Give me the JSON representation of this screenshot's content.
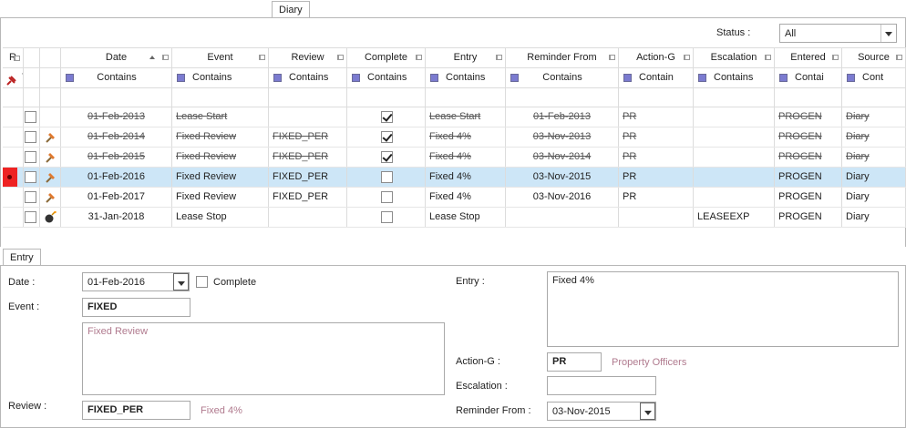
{
  "tabs": {
    "top": "Diary",
    "bottom": "Entry"
  },
  "status": {
    "label": "Status :",
    "value": "All"
  },
  "grid": {
    "columns": [
      {
        "key": "r",
        "label": "R"
      },
      {
        "key": "c1",
        "label": ""
      },
      {
        "key": "c2",
        "label": ""
      },
      {
        "key": "date",
        "label": "Date"
      },
      {
        "key": "event",
        "label": "Event"
      },
      {
        "key": "review",
        "label": "Review"
      },
      {
        "key": "complete",
        "label": "Complete"
      },
      {
        "key": "entry",
        "label": "Entry"
      },
      {
        "key": "reminder",
        "label": "Reminder From"
      },
      {
        "key": "action",
        "label": "Action-G"
      },
      {
        "key": "escalation",
        "label": "Escalation"
      },
      {
        "key": "entered",
        "label": "Entered"
      },
      {
        "key": "source",
        "label": "Source"
      }
    ],
    "filters": {
      "r_dot": "·",
      "c1_dot": "·",
      "date": "Contains",
      "event": "Contains",
      "review": "Contains",
      "complete": "Contains",
      "entry": "Contains",
      "reminder": "Contains",
      "action": "Contain",
      "escalation": "Contains",
      "entered": "Contai",
      "source": "Cont"
    },
    "rows": [
      {
        "date": "01-Feb-2013",
        "event": "Lease Start",
        "review": "",
        "complete": true,
        "entry": "Lease Start",
        "reminder": "01-Feb-2013",
        "action": "PR",
        "escalation": "",
        "entered": "PROGEN",
        "source": "Diary",
        "strike": true,
        "icon": "none"
      },
      {
        "date": "01-Feb-2014",
        "event": "Fixed Review",
        "review": "FIXED_PER",
        "complete": true,
        "entry": "Fixed 4%",
        "reminder": "03-Nov-2013",
        "action": "PR",
        "escalation": "",
        "entered": "PROGEN",
        "source": "Diary",
        "strike": true,
        "icon": "hammer"
      },
      {
        "date": "01-Feb-2015",
        "event": "Fixed Review",
        "review": "FIXED_PER",
        "complete": true,
        "entry": "Fixed 4%",
        "reminder": "03-Nov-2014",
        "action": "PR",
        "escalation": "",
        "entered": "PROGEN",
        "source": "Diary",
        "strike": true,
        "icon": "hammer"
      },
      {
        "date": "01-Feb-2016",
        "event": "Fixed Review",
        "review": "FIXED_PER",
        "complete": false,
        "entry": "Fixed 4%",
        "reminder": "03-Nov-2015",
        "action": "PR",
        "escalation": "",
        "entered": "PROGEN",
        "source": "Diary",
        "strike": false,
        "icon": "hammer",
        "selected": true
      },
      {
        "date": "01-Feb-2017",
        "event": "Fixed Review",
        "review": "FIXED_PER",
        "complete": false,
        "entry": "Fixed 4%",
        "reminder": "03-Nov-2016",
        "action": "PR",
        "escalation": "",
        "entered": "PROGEN",
        "source": "Diary",
        "strike": false,
        "icon": "hammer"
      },
      {
        "date": "31-Jan-2018",
        "event": "Lease Stop",
        "review": "",
        "complete": false,
        "entry": "Lease Stop",
        "reminder": "",
        "action": "",
        "escalation": "LEASEEXP",
        "entered": "PROGEN",
        "source": "Diary",
        "strike": false,
        "icon": "bomb"
      }
    ]
  },
  "form": {
    "date_label": "Date :",
    "date_value": "01-Feb-2016",
    "complete_label": "Complete",
    "event_label": "Event :",
    "event_value": "FIXED",
    "event_desc": "Fixed Review",
    "review_label": "Review :",
    "review_value": "FIXED_PER",
    "review_desc": "Fixed 4%",
    "entry_label": "Entry :",
    "entry_value": "Fixed 4%",
    "action_label": "Action-G :",
    "action_value": "PR",
    "action_desc": "Property Officers",
    "escalation_label": "Escalation :",
    "escalation_value": "",
    "reminder_label": "Reminder From :",
    "reminder_value": "03-Nov-2015"
  },
  "colors": {
    "selected_row": "#cde6f7",
    "indicator": "#e22222",
    "filter_square": "#7b7bd0",
    "muted_text": "#b07a8e"
  }
}
